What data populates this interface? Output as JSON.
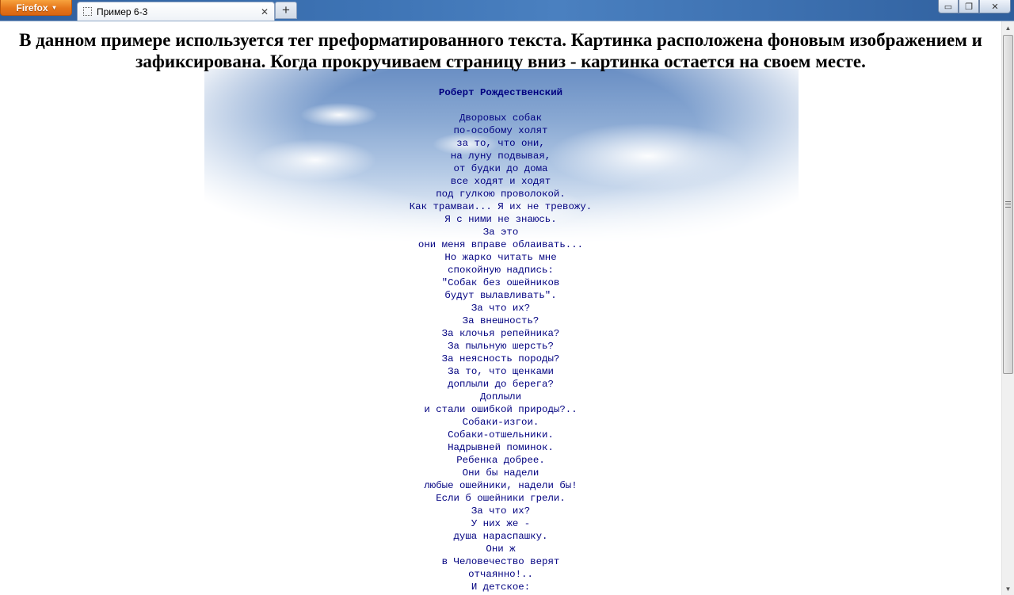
{
  "browser": {
    "menu_button_label": "Firefox",
    "menu_caret_icon": "▾",
    "tab_title": "Пример 6-3",
    "tab_close_glyph": "✕",
    "new_tab_glyph": "+",
    "minimize_glyph": "▭",
    "restore_glyph": "❐",
    "close_glyph": "✕"
  },
  "page": {
    "heading": "В данном примере используется тег преформатированного текста. Картинка расположена фоновым изображением и зафиксирована. Когда прокручиваем страницу вниз - картинка остается на своем месте.",
    "poem_author": "Роберт Рождественский",
    "poem_lines": [
      "Дворовых собак",
      "по-особому холят",
      "за то, что они,",
      "на луну подвывая,",
      "от будки до дома",
      "все ходят и ходят",
      "под гулкою проволокой.",
      "Как трамваи... Я их не тревожу.",
      "Я с ними не знаюсь.",
      "За это",
      "они меня вправе облаивать...",
      "Но жарко читать мне",
      "спокойную надпись:",
      "\"Собак без ошейников",
      "будут вылавливать\".",
      "За что их?",
      "За внешность?",
      "За клочья репейника?",
      "За пыльную шерсть?",
      "За неясность породы?",
      "За то, что щенками",
      "доплыли до берега?",
      "Доплыли",
      "и стали ошибкой природы?..",
      "Собаки-изгои.",
      "Собаки-отшельники.",
      "Надрывней поминок.",
      "Ребенка добрее.",
      "Они бы надели",
      "любые ошейники, надели бы!",
      "Если б ошейники грели.",
      "За что их?",
      "У них же -",
      "душа нараспашку.",
      "Они ж",
      "в Человечество верят",
      "отчаянно!..",
      "И детское:"
    ]
  },
  "scrollbar": {
    "up_glyph": "▲",
    "down_glyph": "▼",
    "thumb_fraction": 0.62
  }
}
